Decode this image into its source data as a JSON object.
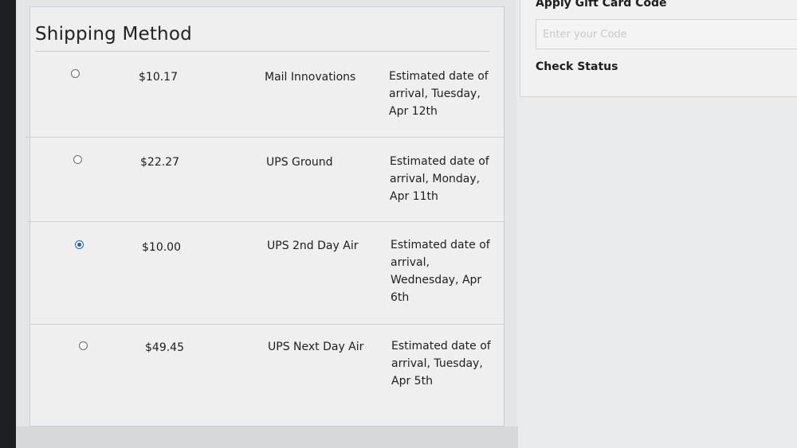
{
  "shipping": {
    "title": "Shipping Method",
    "options": [
      {
        "price": "$10.17",
        "carrier": "Mail Innovations",
        "eta_lines": [
          "Estimated date of",
          "arrival, Tuesday,",
          "Apr 12th"
        ],
        "selected": false
      },
      {
        "price": "$22.27",
        "carrier": "UPS Ground",
        "eta_lines": [
          "Estimated date of",
          "arrival, Monday,",
          "Apr 11th"
        ],
        "selected": false
      },
      {
        "price": "$10.00",
        "carrier": "UPS 2nd Day Air",
        "eta_lines": [
          "Estimated date of",
          "arrival,",
          "Wednesday, Apr",
          "6th"
        ],
        "selected": true
      },
      {
        "price": "$49.45",
        "carrier": "UPS Next Day Air",
        "eta_lines": [
          "Estimated date of",
          "arrival, Tuesday,",
          "Apr 5th"
        ],
        "selected": false
      }
    ]
  },
  "gift_card": {
    "title": "Apply Gift Card Code",
    "placeholder": "Enter your Code",
    "check_status_label": "Check Status"
  },
  "colors": {
    "radio_selected": "#1a5fd8"
  }
}
